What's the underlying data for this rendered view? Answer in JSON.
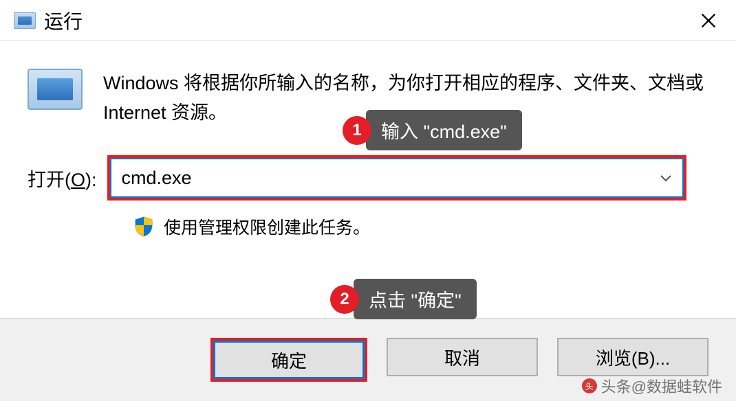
{
  "window": {
    "title": "运行"
  },
  "description": "Windows 将根据你所输入的名称，为你打开相应的程序、文件夹、文档或 Internet 资源。",
  "open_label_prefix": "打开(",
  "open_label_underline": "O",
  "open_label_suffix": "):",
  "input_value": "cmd.exe",
  "admin_text": "使用管理权限创建此任务。",
  "buttons": {
    "ok": "确定",
    "cancel": "取消",
    "browse": "浏览(B)..."
  },
  "callouts": {
    "one": {
      "num": "1",
      "text": "输入 \"cmd.exe\""
    },
    "two": {
      "num": "2",
      "text": "点击 \"确定\""
    }
  },
  "watermark": "头条@数据蛙软件"
}
